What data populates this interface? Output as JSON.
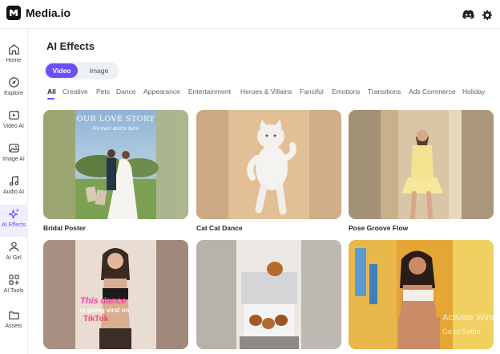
{
  "app": {
    "name": "Media.io"
  },
  "header": {
    "icons": [
      "discord-icon",
      "gear-icon"
    ]
  },
  "sidebar": {
    "items": [
      {
        "label": "Home",
        "icon": "home-icon"
      },
      {
        "label": "Explore",
        "icon": "compass-icon"
      },
      {
        "label": "Video AI",
        "icon": "video-icon"
      },
      {
        "label": "Image AI",
        "icon": "image-icon"
      },
      {
        "label": "Audio AI",
        "icon": "music-icon"
      },
      {
        "label": "AI Effects",
        "icon": "sparkle-icon",
        "active": true
      },
      {
        "label": "AI Girl",
        "icon": "person-icon"
      },
      {
        "label": "AI Tools",
        "icon": "grid-icon"
      },
      {
        "label": "Assets",
        "icon": "folder-icon"
      }
    ]
  },
  "main": {
    "title": "AI Effects",
    "toggle": {
      "video": "Video",
      "image": "Image",
      "selected": "Video"
    },
    "tabs": [
      "All",
      "Creative",
      "Pets",
      "Dance",
      "Appearance",
      "Entertainment",
      "Heroes & Villains",
      "Fanciful",
      "Emotions",
      "Transitions",
      "Ads Commerce",
      "Holiday"
    ],
    "active_tab": "All",
    "cards": [
      {
        "label": "Bridal Poster",
        "overlay_title": "OUR LOVE STORY",
        "overlay_sub": "Forever starts here"
      },
      {
        "label": "Cat Cat Dance"
      },
      {
        "label": "Pose Groove Flow"
      },
      {
        "label": "",
        "overlay_title": "This dance",
        "overlay_sub": "is going viral on",
        "overlay_tag": "TikTok"
      },
      {
        "label": ""
      },
      {
        "label": ""
      }
    ]
  },
  "watermark": {
    "line1": "Activate Wind",
    "line2": "Go to Settin"
  },
  "colors": {
    "accent": "#6d4ff6",
    "text": "#1f2329"
  }
}
